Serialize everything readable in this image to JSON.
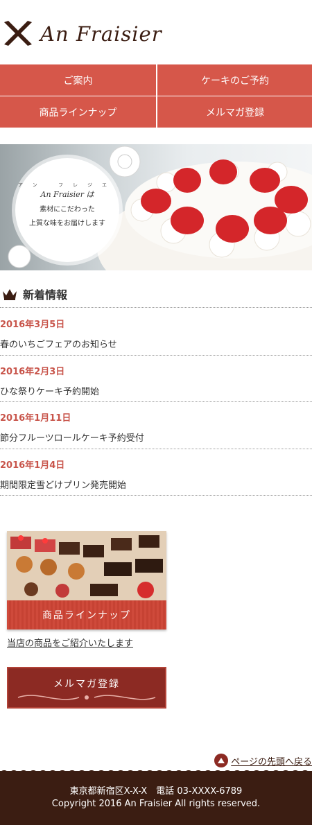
{
  "header": {
    "logo_text": "An Fraisier"
  },
  "nav": {
    "items": [
      {
        "label": "ご案内"
      },
      {
        "label": "ケーキのご予約"
      },
      {
        "label": "商品ラインナップ"
      },
      {
        "label": "メルマガ登録"
      }
    ]
  },
  "hero": {
    "ruby": "アン フレジエ",
    "brand": "An Fraisier",
    "brand_suffix": "は",
    "line1": "素材にこだわった",
    "line2": "上質な味をお届けします"
  },
  "news": {
    "title": "新着情報",
    "items": [
      {
        "date": "2016年3月5日",
        "text": "春のいちごフェアのお知らせ"
      },
      {
        "date": "2016年2月3日",
        "text": "ひな祭りケーキ予約開始"
      },
      {
        "date": "2016年1月11日",
        "text": "節分フルーツロールケーキ予約受付"
      },
      {
        "date": "2016年1月4日",
        "text": "期間限定雪どけプリン発売開始"
      }
    ]
  },
  "banners": {
    "product_label": "商品ラインナップ",
    "product_link": "当店の商品をご紹介いたします",
    "mail_label": "メルマガ登録"
  },
  "pagetop": {
    "label": "ページの先頭へ戻る"
  },
  "footer": {
    "address": "東京都新宿区X-X-X　電話 03-XXXX-6789",
    "copyright": "Copyright 2016 An Fraisier All rights reserved."
  },
  "colors": {
    "accent": "#d6574a",
    "brown": "#3b1d12",
    "date": "#c8544a",
    "mail": "#8c2a23"
  }
}
